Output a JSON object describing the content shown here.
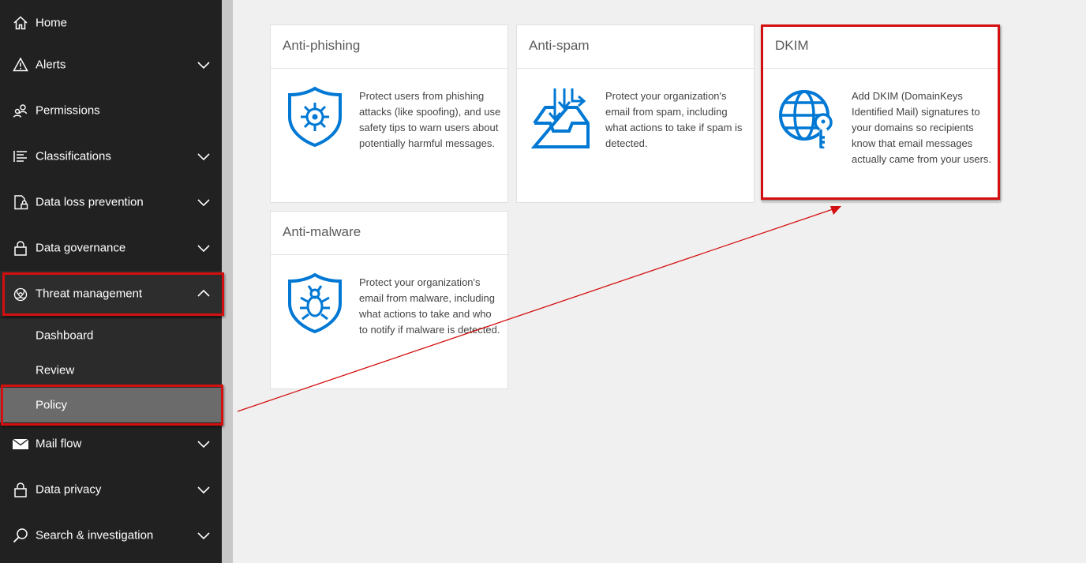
{
  "sidebar": {
    "items": [
      {
        "label": "Home",
        "icon": "home-icon",
        "chevron": false
      },
      {
        "label": "Alerts",
        "icon": "warning-icon",
        "chevron": "down"
      },
      {
        "label": "Permissions",
        "icon": "people-icon",
        "chevron": false
      },
      {
        "label": "Classifications",
        "icon": "list-icon",
        "chevron": "down"
      },
      {
        "label": "Data loss prevention",
        "icon": "document-lock-icon",
        "chevron": "down"
      },
      {
        "label": "Data governance",
        "icon": "lock-icon",
        "chevron": "down"
      },
      {
        "label": "Threat management",
        "icon": "biohazard-icon",
        "chevron": "up"
      },
      {
        "label": "Mail flow",
        "icon": "mail-icon",
        "chevron": "down"
      },
      {
        "label": "Data privacy",
        "icon": "lock-icon",
        "chevron": "down"
      },
      {
        "label": "Search & investigation",
        "icon": "search-icon",
        "chevron": "down"
      }
    ],
    "threat_submenu": [
      {
        "label": "Dashboard"
      },
      {
        "label": "Review"
      },
      {
        "label": "Policy"
      }
    ],
    "active_item": "Policy"
  },
  "cards": [
    {
      "title": "Anti-phishing",
      "icon": "shield-wheel-icon",
      "description": "Protect users from phishing attacks (like spoofing), and use safety tips to warn users about potentially harmful messages."
    },
    {
      "title": "Anti-spam",
      "icon": "inbox-arrows-icon",
      "description": "Protect your organization's email from spam, including what actions to take if spam is detected."
    },
    {
      "title": "DKIM",
      "icon": "globe-key-icon",
      "description": "Add DKIM (DomainKeys Identified Mail) signatures to your domains so recipients know that email messages actually came from your users."
    },
    {
      "title": "Anti-malware",
      "icon": "shield-bug-icon",
      "description": "Protect your organization's email from malware, including what actions to take and who to notify if malware is detected."
    }
  ],
  "colors": {
    "sidebar_bg": "#212121",
    "accent_blue": "#0078d4",
    "annotation_red": "#d40f0f",
    "active_item_bg": "#6b6b6b"
  }
}
